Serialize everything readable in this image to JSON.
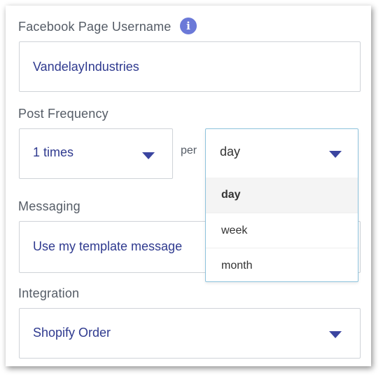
{
  "facebook": {
    "label": "Facebook Page Username",
    "value": "VandelayIndustries",
    "info_icon": "info-icon"
  },
  "frequency": {
    "label": "Post Frequency",
    "times_value": "1 times",
    "per_label": "per",
    "period_value": "day",
    "options": [
      "day",
      "week",
      "month"
    ],
    "selected_option": "day"
  },
  "messaging": {
    "label": "Messaging",
    "value": "Use my template message"
  },
  "integration": {
    "label": "Integration",
    "value": "Shopify Order"
  },
  "colors": {
    "accent": "#3b45a0",
    "info": "#6b79d8",
    "focus_border": "#8ec3dd"
  }
}
